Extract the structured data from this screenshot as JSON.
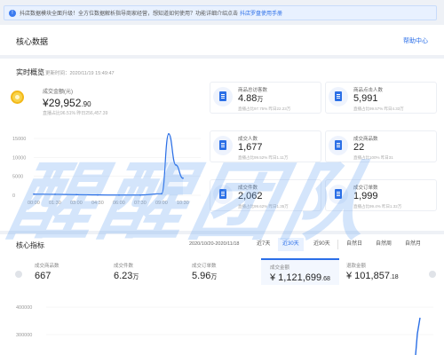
{
  "notice": {
    "icon": "info-icon",
    "text": "抖店数据模块全面升级！全方位数据解析指导商家经营，想知道如何使用？功能详细介绍点击",
    "link": "抖店罗盘使用手册"
  },
  "header": {
    "title": "核心数据",
    "help": "帮助中心"
  },
  "realtime": {
    "title": "实时概览",
    "updated": "更新时间：2020/11/19 15:49:47",
    "gmv": {
      "label": "成交金额(元)",
      "currency": "¥",
      "int": "29,952",
      "dec": ".90",
      "sub": "直播占比96.51%  昨日256,457.39"
    },
    "chart": {
      "yticks": [
        "15000",
        "10000",
        "5000",
        "0"
      ],
      "xticks": [
        "00:00",
        "01:30",
        "03:00",
        "04:30",
        "06:00",
        "07:30",
        "09:00",
        "10:30"
      ]
    },
    "metrics": [
      {
        "label": "商品总访客数",
        "value": "4.88",
        "unit": "万",
        "sub": "直播占比97.75%  昨日22.23万"
      },
      {
        "label": "商品点击人数",
        "value": "5,991",
        "unit": "",
        "sub": "直播占比99.57%  昨日4.33万"
      },
      {
        "label": "成交人数",
        "value": "1,677",
        "unit": "",
        "sub": "直播占比99.52%  昨日1.11万"
      },
      {
        "label": "成交商品数",
        "value": "22",
        "unit": "",
        "sub": "直播占比100%  昨日31"
      },
      {
        "label": "成交件数",
        "value": "2,062",
        "unit": "",
        "sub": "直播占比99.62%  昨日1.35万"
      },
      {
        "label": "成交订单数",
        "value": "1,999",
        "unit": "",
        "sub": "直播占比99.4%  昨日1.32万"
      }
    ]
  },
  "watermark": "醒醒团队",
  "core": {
    "title": "核心指标",
    "range": "2020/10/20-2020/11/18",
    "tabs": [
      "近7天",
      "近30天",
      "近90天",
      "自然日",
      "自然周",
      "自然月"
    ],
    "active_tab": "近30天",
    "kpis": [
      {
        "label": "成交商品数",
        "value": "667",
        "unit": ""
      },
      {
        "label": "成交件数",
        "value": "6.23",
        "unit": "万"
      },
      {
        "label": "成交订单数",
        "value": "5.96",
        "unit": "万"
      },
      {
        "label": "成交金额",
        "value": "¥ 1,121,699",
        "unit": ".68"
      },
      {
        "label": "退款金额",
        "value": "¥ 101,857",
        "unit": ".18"
      }
    ],
    "chart": {
      "yticks": [
        "400000",
        "300000"
      ]
    }
  },
  "chart_data": {
    "type": "line",
    "title": "",
    "xlabel": "",
    "ylabel": "",
    "x": [
      "00:00",
      "01:30",
      "03:00",
      "04:30",
      "06:00",
      "07:30",
      "09:00",
      "09:30",
      "10:00",
      "10:30"
    ],
    "values": [
      300,
      250,
      150,
      80,
      50,
      60,
      400,
      16500,
      8000,
      4500
    ],
    "ylim": [
      0,
      15000
    ],
    "color": "#2b6fe6"
  }
}
